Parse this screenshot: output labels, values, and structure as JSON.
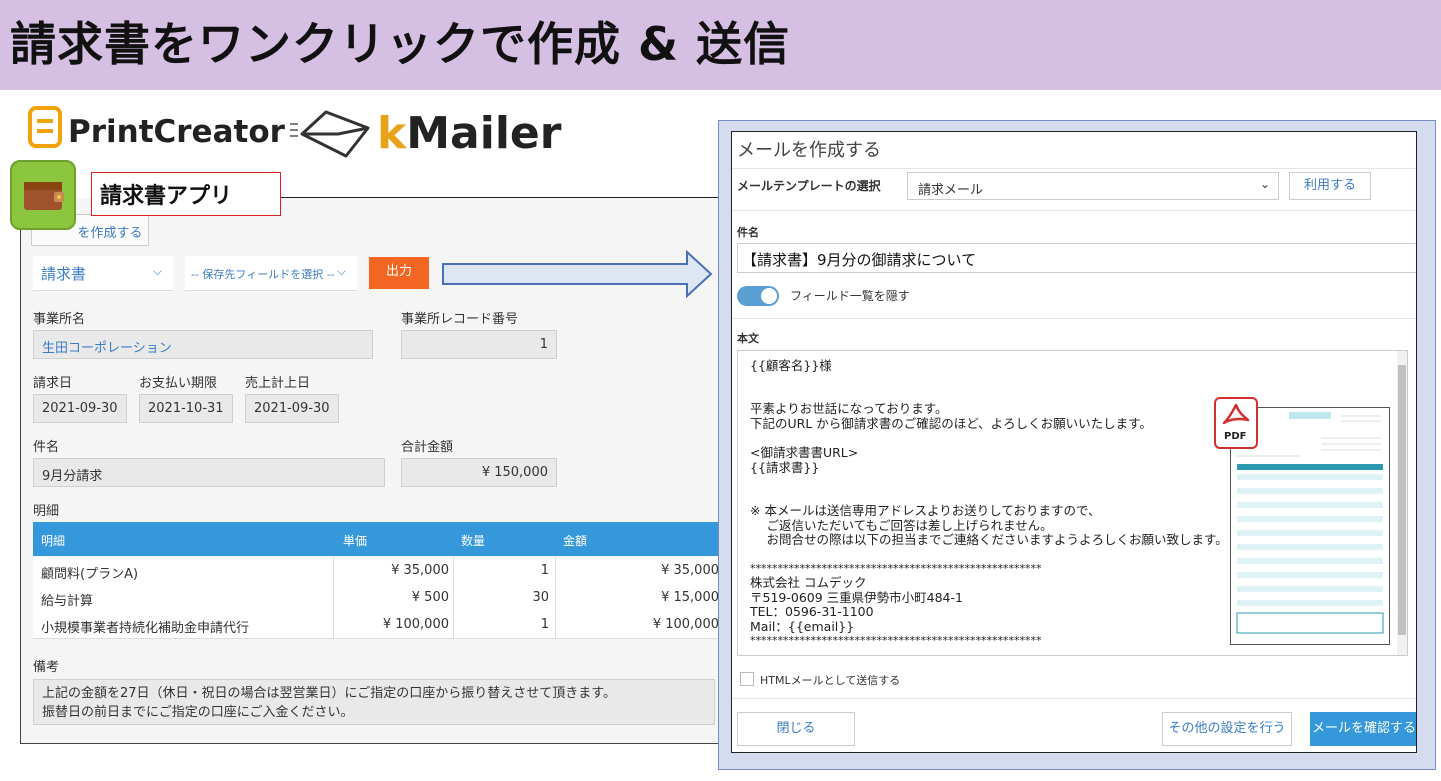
{
  "header": {
    "title": "請求書をワンクリックで作成 & 送信"
  },
  "logos": {
    "printcreator": "PrintCreator",
    "kmailer_k": "k",
    "kmailer_rest": "Mailer"
  },
  "app": {
    "label": "請求書アプリ",
    "create_button": "を作成する"
  },
  "toolbar": {
    "template_select": "請求書",
    "field_select": "-- 保存先フィールドを選択 --",
    "output_button": "出力"
  },
  "record": {
    "office_name_label": "事業所名",
    "office_name_value": "生田コーポレーション",
    "office_record_label": "事業所レコード番号",
    "office_record_value": "1",
    "invoice_date_label": "請求日",
    "invoice_date_value": "2021-09-30",
    "due_date_label": "お支払い期限",
    "due_date_value": "2021-10-31",
    "sales_date_label": "売上計上日",
    "sales_date_value": "2021-09-30",
    "subject_label": "件名",
    "subject_value": "9月分請求",
    "total_label": "合計金額",
    "total_value": "¥ 150,000",
    "detail_label": "明細",
    "table_headers": [
      "明細",
      "単価",
      "数量",
      "金額"
    ],
    "rows": [
      {
        "item": "顧問料(プランA)",
        "unit": "¥ 35,000",
        "qty": "1",
        "amount": "¥ 35,000"
      },
      {
        "item": "給与計算",
        "unit": "¥ 500",
        "qty": "30",
        "amount": "¥ 15,000"
      },
      {
        "item": "小規模事業者持続化補助金申請代行",
        "unit": "¥ 100,000",
        "qty": "1",
        "amount": "¥ 100,000"
      }
    ],
    "remarks_label": "備考",
    "remarks_line1": "上記の金額を27日（休日・祝日の場合は翌営業日）にご指定の口座から振り替えさせて頂きます。",
    "remarks_line2": "振替日の前日までにご指定の口座にご入金ください。"
  },
  "dialog": {
    "title": "メールを作成する",
    "template_label": "メールテンプレートの選択",
    "template_value": "請求メール",
    "use_button": "利用する",
    "subject_label": "件名",
    "subject_value": "【請求書】9月分の御請求について",
    "toggle_label": "フィールド一覧を隠す",
    "body_label": "本文",
    "body_lines": [
      "{{顧客名}}様",
      "",
      "",
      "平素よりお世話になっております。",
      "下記のURL から御請求書のご確認のほど、よろしくお願いいたします。",
      "",
      "<御請求書書URL>",
      "{{請求書}}",
      "",
      "",
      "※ 本メールは送信専用アドレスよりお送りしておりますので、",
      "　 ご返信いただいてもご回答は差し上げられません。",
      "　 お問合せの際は以下の担当までご連絡くださいますようよろしくお願い致します。",
      "",
      "*****************************************************",
      "株式会社 コムデック",
      "〒519-0609 三重県伊勢市小町484-1",
      "TEL：0596-31-1100",
      "Mail：{{email}}",
      "*****************************************************"
    ],
    "pdf_label": "PDF",
    "html_checkbox_label": "HTMLメールとして送信する",
    "close_button": "閉じる",
    "other_settings_button": "その他の設定を行う",
    "confirm_button": "メールを確認する"
  },
  "colors": {
    "header_bg": "#d5bfe3",
    "accent_blue": "#3498db",
    "output_orange": "#f26522"
  }
}
